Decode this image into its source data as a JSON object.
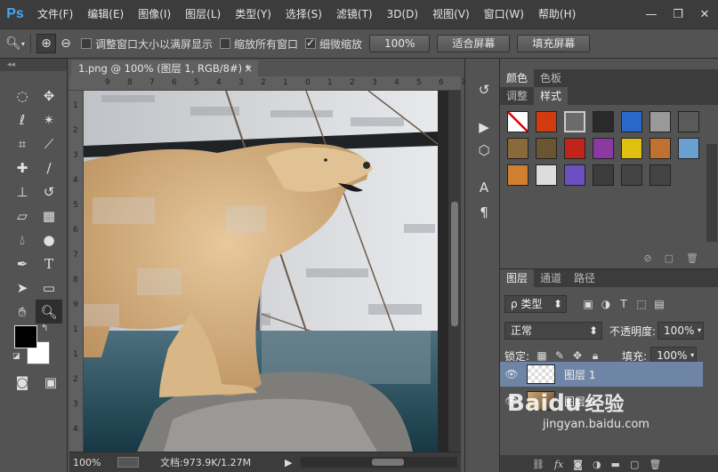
{
  "app": {
    "logo": "Ps"
  },
  "menu": [
    "文件(F)",
    "编辑(E)",
    "图像(I)",
    "图层(L)",
    "类型(Y)",
    "选择(S)",
    "滤镜(T)",
    "3D(D)",
    "视图(V)",
    "窗口(W)",
    "帮助(H)"
  ],
  "window_controls": {
    "minimize": "—",
    "restore": "❐",
    "close": "✕"
  },
  "options": {
    "zoom_tool_icon": "zoom-icon",
    "chk_resize_windows": {
      "label": "调整窗口大小以满屏显示",
      "checked": false
    },
    "chk_zoom_all": {
      "label": "缩放所有窗口",
      "checked": false
    },
    "chk_scrubby": {
      "label": "细微缩放",
      "checked": true
    },
    "btn_100": "100%",
    "btn_fit": "适合屏幕",
    "btn_fill": "填充屏幕"
  },
  "document": {
    "tab_title": "1.png @ 100% (图层 1, RGB/8#) *",
    "tab_close": "×",
    "zoom": "100%",
    "doc_info": "文档:973.9K/1.27M",
    "ruler_top": [
      "9",
      "8",
      "7",
      "6",
      "5",
      "4",
      "3",
      "2",
      "1",
      "0",
      "1",
      "2",
      "3",
      "4",
      "5",
      "6",
      "7",
      "8"
    ],
    "ruler_left": [
      "1",
      "2",
      "3",
      "4",
      "5",
      "6",
      "7",
      "8",
      "9",
      "1",
      "1",
      "2",
      "3",
      "4"
    ]
  },
  "panels": {
    "top_tabs_a": [
      "颜色",
      "色板"
    ],
    "top_tabs_b": [
      "调整",
      "样式"
    ],
    "layers_tabs": [
      "图层",
      "通道",
      "路径"
    ],
    "filter_kind": "ρ 类型",
    "blend_mode": "正常",
    "opacity_label": "不透明度:",
    "opacity_value": "100%",
    "lock_label": "锁定:",
    "fill_label": "填充:",
    "fill_value": "100%",
    "layers": [
      {
        "name": "图层 1",
        "selected": true
      },
      {
        "name": "图层 0",
        "selected": false
      }
    ]
  },
  "colors": {
    "style_swatches": [
      "#ffffff",
      "#d23a10",
      "#6b6b6b",
      "#2a2a2a",
      "#2a68c9",
      "#9a9a9a",
      "#5a5a5a",
      "#8a6a3a",
      "#6a5530",
      "#c0241a",
      "#8a3aa0",
      "#e0c010",
      "#c07030",
      "#6aa0d0",
      "#d08030",
      "#dddddd",
      "#6a50c0",
      "#3d3d3d",
      "#444444",
      "#444444"
    ]
  },
  "watermark": {
    "brand": "Baidu",
    "sub": "经验",
    "url": "jingyan.baidu.com"
  }
}
